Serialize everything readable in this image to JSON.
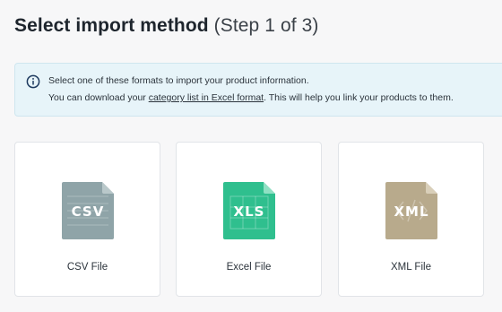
{
  "header": {
    "title": "Select import method",
    "step": "(Step 1 of 3)"
  },
  "info": {
    "icon": "info-circle-icon",
    "line1": "Select one of these formats to import your product information.",
    "line2_before": "You can download your ",
    "line2_link": "category list in Excel format",
    "line2_after": ". This will help you link your products to them."
  },
  "import_options": [
    {
      "badge": "CSV",
      "label": "CSV File",
      "icon": "csv-file-icon",
      "color": "#8fa4a8"
    },
    {
      "badge": "XLS",
      "label": "Excel File",
      "icon": "excel-file-icon",
      "color": "#2fbf8e"
    },
    {
      "badge": "XML",
      "label": "XML File",
      "icon": "xml-file-icon",
      "color": "#b8aa8c"
    }
  ],
  "colors": {
    "banner_background": "#e7f4f9",
    "page_background": "#f7f7f8",
    "card_border": "#e1e4e8"
  }
}
